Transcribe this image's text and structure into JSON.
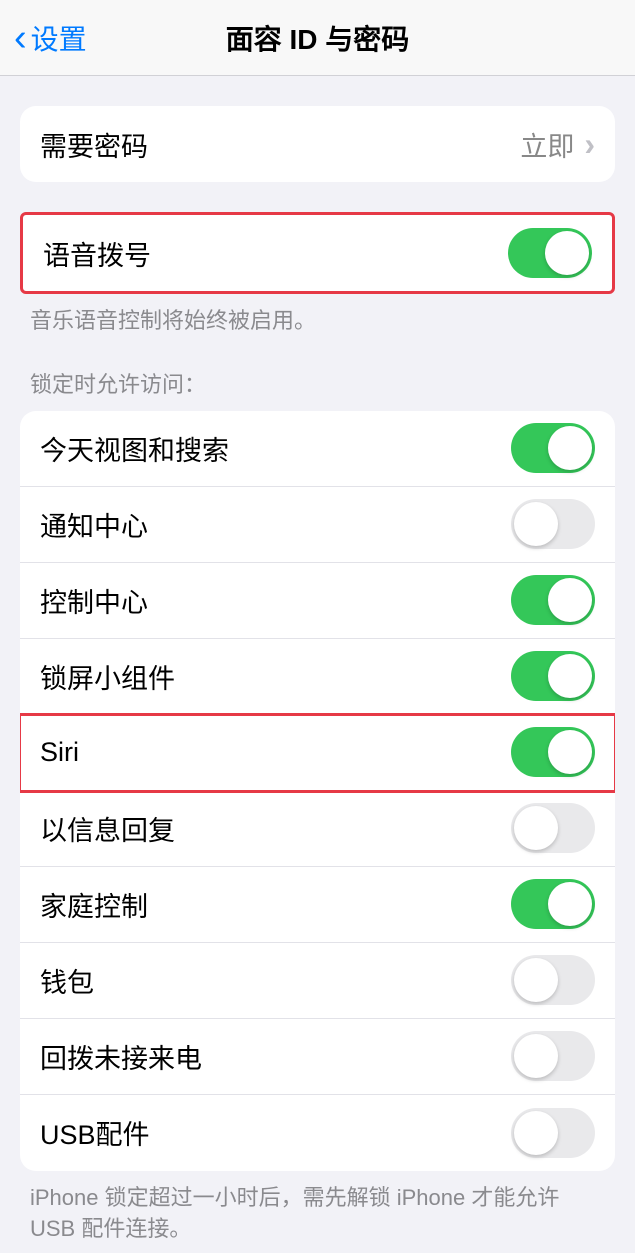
{
  "header": {
    "back_label": "设置",
    "title": "面容 ID 与密码"
  },
  "passcode_row": {
    "label": "需要密码",
    "value": "立即"
  },
  "voice_dial": {
    "label": "语音拨号",
    "on": true,
    "footer": "音乐语音控制将始终被启用。"
  },
  "lock_access": {
    "section_title": "锁定时允许访问：",
    "items": [
      {
        "label": "今天视图和搜索",
        "on": true
      },
      {
        "label": "通知中心",
        "on": false
      },
      {
        "label": "控制中心",
        "on": true
      },
      {
        "label": "锁屏小组件",
        "on": true
      },
      {
        "label": "Siri",
        "on": true
      },
      {
        "label": "以信息回复",
        "on": false
      },
      {
        "label": "家庭控制",
        "on": true
      },
      {
        "label": "钱包",
        "on": false
      },
      {
        "label": "回拨未接来电",
        "on": false
      },
      {
        "label": "USB配件",
        "on": false
      }
    ],
    "footer": "iPhone 锁定超过一小时后，需先解锁 iPhone 才能允许 USB 配件连接。"
  }
}
